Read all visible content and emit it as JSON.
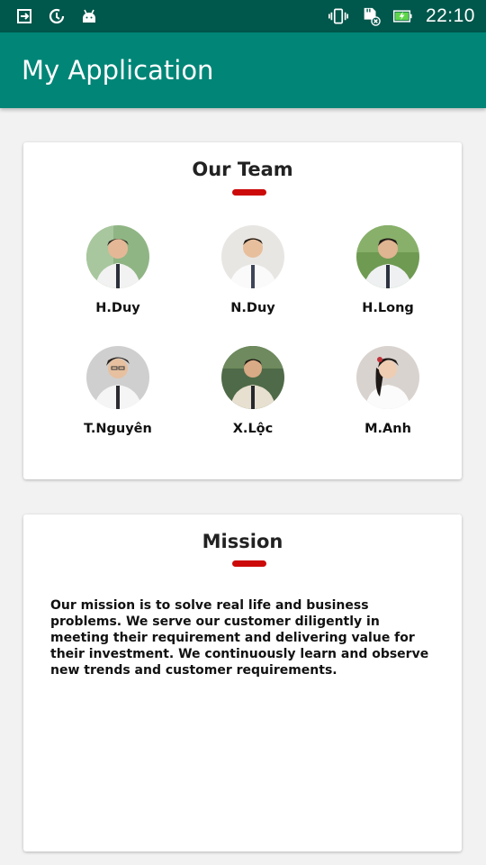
{
  "status_bar": {
    "time": "22:10",
    "icons": [
      "download-icon",
      "data-saver-icon",
      "android-icon",
      "vibrate-icon",
      "sd-card-icon",
      "battery-charging-icon"
    ]
  },
  "app_bar": {
    "title": "My Application"
  },
  "team": {
    "title": "Our Team",
    "members": [
      {
        "name": "H.Duy",
        "avatar": "photo-h-duy"
      },
      {
        "name": "N.Duy",
        "avatar": "photo-n-duy"
      },
      {
        "name": "H.Long",
        "avatar": "photo-h-long"
      },
      {
        "name": "T.Nguyên",
        "avatar": "photo-t-nguyen"
      },
      {
        "name": "X.Lộc",
        "avatar": "photo-x-loc"
      },
      {
        "name": "M.Anh",
        "avatar": "photo-m-anh"
      }
    ]
  },
  "mission": {
    "title": "Mission",
    "text": "Our mission is to solve real life and business problems. We serve our customer diligently in meeting their requirement and delivering value for their investment. We continuously learn and observe new trends and customer requirements."
  },
  "colors": {
    "status_bar": "#00574b",
    "app_bar": "#008577",
    "accent": "#cc0a0a"
  }
}
